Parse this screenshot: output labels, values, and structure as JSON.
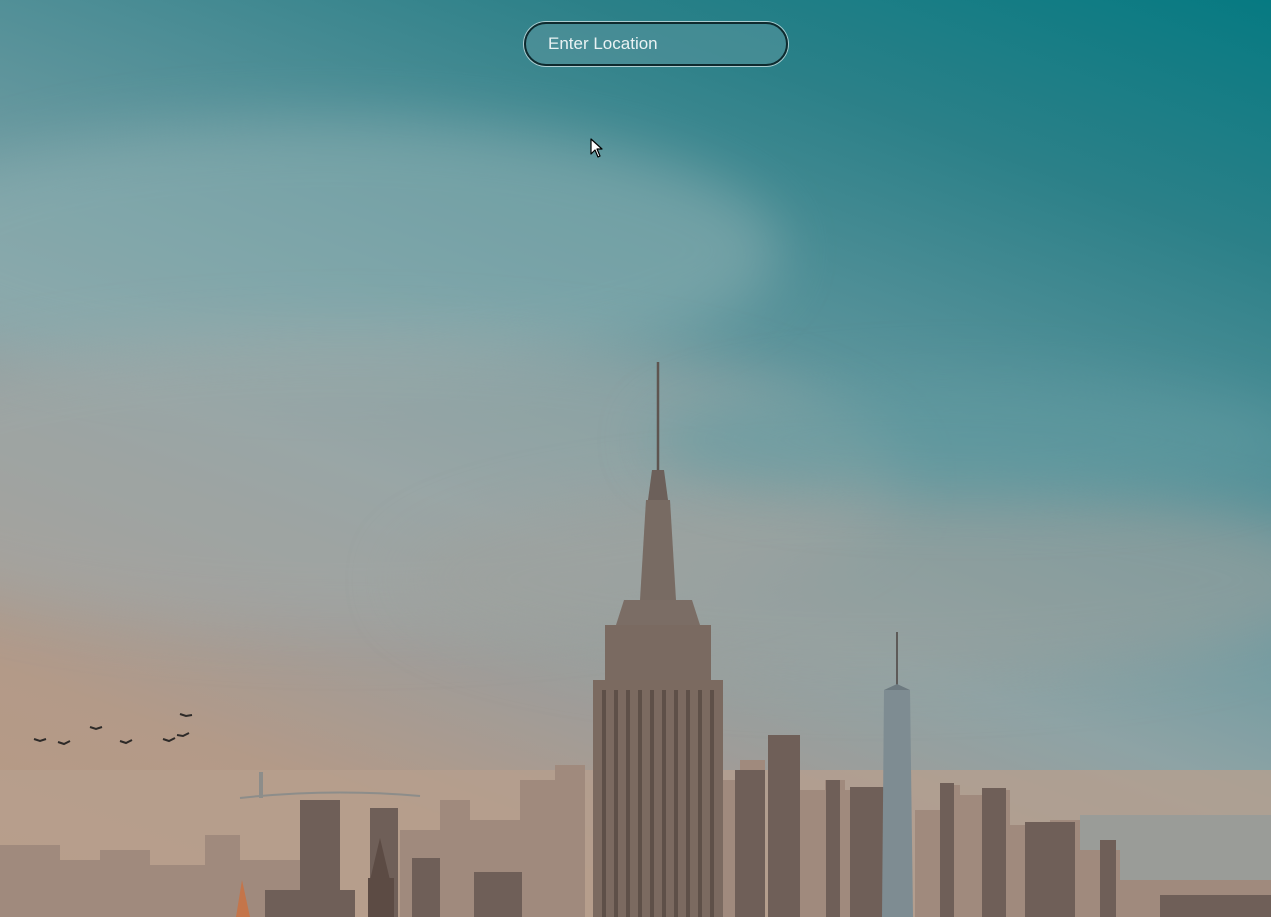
{
  "search": {
    "placeholder": "Enter Location",
    "value": ""
  },
  "background": {
    "scene": "city-skyline-photo",
    "sky_color": "#067a82",
    "haze_color": "#b99a84"
  },
  "cursor": {
    "icon": "arrow-pointer-icon"
  }
}
